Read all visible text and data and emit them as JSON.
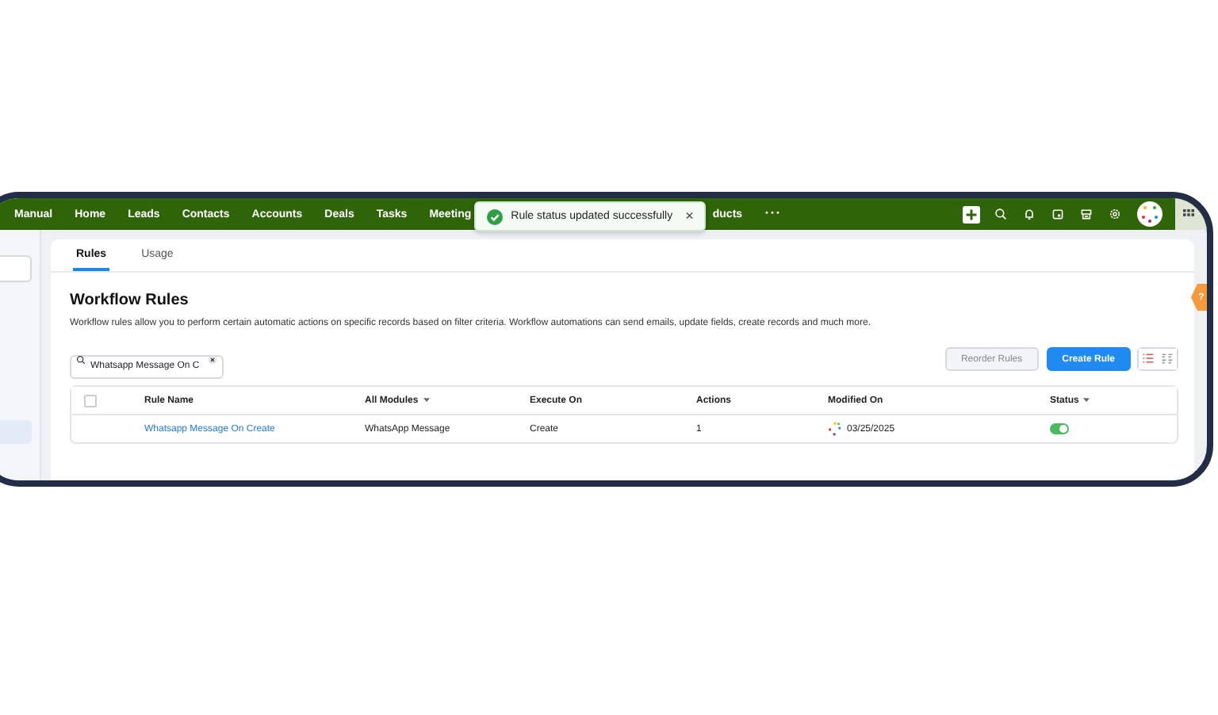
{
  "nav": {
    "items": [
      {
        "label": "Manual"
      },
      {
        "label": "Home"
      },
      {
        "label": "Leads"
      },
      {
        "label": "Contacts"
      },
      {
        "label": "Accounts"
      },
      {
        "label": "Deals"
      },
      {
        "label": "Tasks"
      },
      {
        "label": "Meeting"
      },
      {
        "label": "ducts"
      }
    ],
    "more": "•••"
  },
  "toast": {
    "message": "Rule status updated successfully",
    "close": "×"
  },
  "help": {
    "label": "?"
  },
  "tabs": [
    {
      "label": "Rules",
      "selected": true
    },
    {
      "label": "Usage",
      "selected": false
    }
  ],
  "title": "Workflow Rules",
  "description": "Workflow rules allow you to perform certain automatic actions on specific records based on filter criteria. Workflow automations can send emails, update fields, create records and much more.",
  "search": {
    "value": "Whatsapp Message On C"
  },
  "buttons": [
    {
      "label": "Reorder Rules",
      "kind": "secondary"
    },
    {
      "label": "Create Rule",
      "kind": "primary"
    }
  ],
  "views": [
    {
      "kind": "list",
      "selected": true
    },
    {
      "kind": "grid",
      "selected": false
    }
  ],
  "table": {
    "select_all_checked": false,
    "columns": [
      {
        "label": "Rule Name",
        "dropdown": false
      },
      {
        "label": "All Modules",
        "dropdown": true
      },
      {
        "label": "Execute On",
        "dropdown": false
      },
      {
        "label": "Actions",
        "dropdown": false
      },
      {
        "label": "Modified On",
        "dropdown": false
      },
      {
        "label": "Status",
        "dropdown": true
      }
    ],
    "rows": [
      {
        "rule_name": "Whatsapp Message On Create",
        "module": "WhatsApp Message",
        "execute_on": "Create",
        "actions": "1",
        "modified_on": "03/25/2025",
        "enabled": true
      }
    ]
  }
}
